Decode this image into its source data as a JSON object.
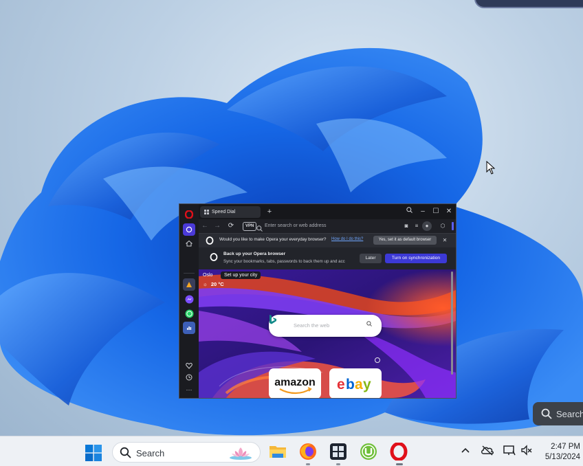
{
  "taskbar": {
    "search_placeholder": "Search",
    "time": "2:47 PM",
    "date": "5/13/2024",
    "apps": [
      "File Explorer",
      "Firefox",
      "Task Manager",
      "uTorrent",
      "Opera"
    ]
  },
  "desktop_widget": {
    "search_label": "Search"
  },
  "browser": {
    "tab_title": "Speed Dial",
    "address_placeholder": "Enter search or web address",
    "vpn_label": "VPN",
    "default_bar": {
      "message": "Would you like to make Opera your everyday browser?",
      "link": "How do I do this?",
      "button": "Yes, set it as default browser"
    },
    "sync_bar": {
      "title": "Back up your Opera browser",
      "description": "Sync your bookmarks, tabs, passwords to back them up and acc",
      "later_label": "Later",
      "sync_label": "Turn on synchronization"
    },
    "weather": {
      "city": "Oslo",
      "set_city": "Set up your city",
      "temperature": "20 °C"
    },
    "search_placeholder": "Search the web",
    "speed_dial": [
      "amazon",
      "ebay"
    ]
  },
  "colors": {
    "accent": "#3c39d6",
    "opera_red": "#e0101a",
    "wallpaper_blue": "#1a5fd8"
  }
}
